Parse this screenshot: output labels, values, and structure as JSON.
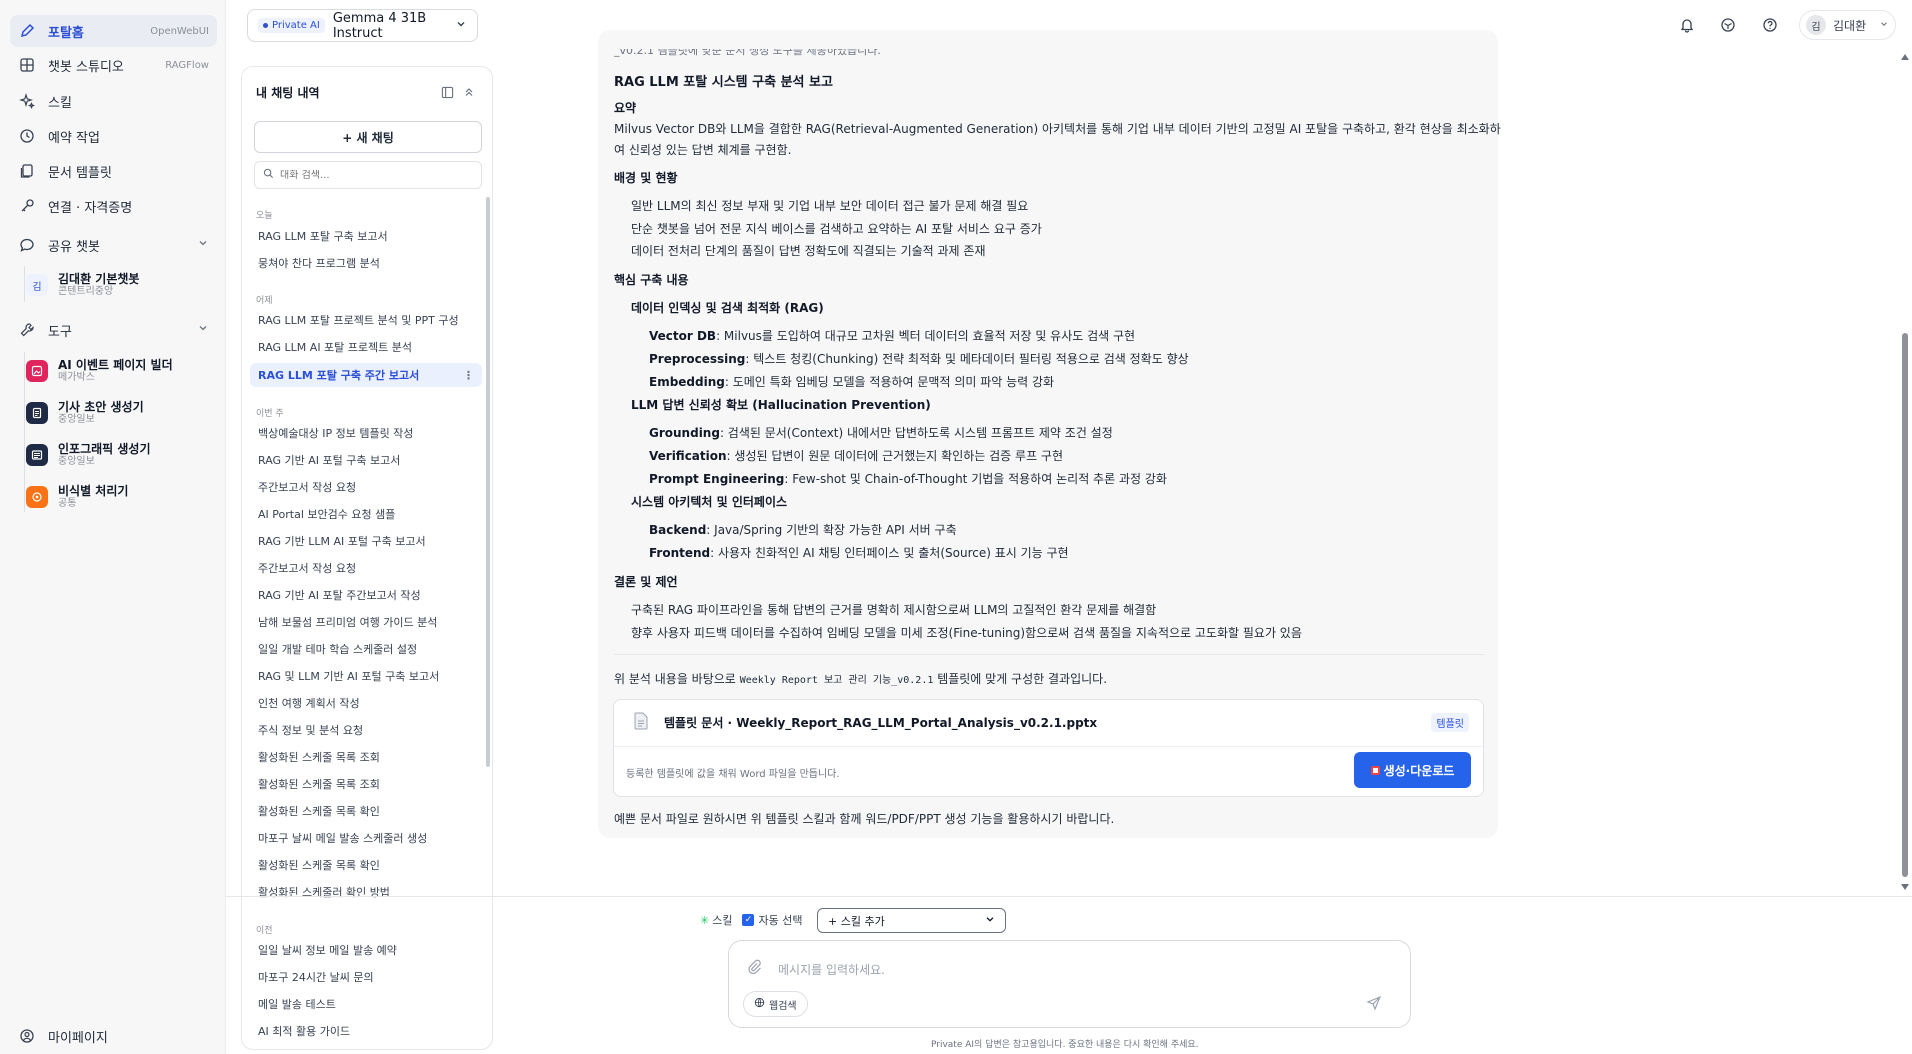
{
  "nav": {
    "items": [
      {
        "label": "포탈홈",
        "tag": "OpenWebUI"
      },
      {
        "label": "챗봇 스튜디오",
        "tag": "RAGFlow"
      },
      {
        "label": "스킬",
        "tag": ""
      },
      {
        "label": "예약 작업",
        "tag": ""
      },
      {
        "label": "문서 템플릿",
        "tag": ""
      },
      {
        "label": "연결 · 자격증명",
        "tag": ""
      }
    ],
    "shared_label": "공유 챗봇",
    "shared_bot": {
      "badge": "김",
      "name": "김대환 기본챗봇",
      "sub": "콘텐트리중앙"
    },
    "tools_label": "도구",
    "tools": [
      {
        "name": "AI 이벤트 페이지 빌더",
        "sub": "메가박스",
        "color": "#e0245e"
      },
      {
        "name": "기사 초안 생성기",
        "sub": "중앙일보",
        "color": "#1f2a44"
      },
      {
        "name": "인포그래픽 생성기",
        "sub": "중앙일보",
        "color": "#1f2a44"
      },
      {
        "name": "비식별 처리기",
        "sub": "공통",
        "color": "#f97316"
      }
    ],
    "mypage": "마이페이지"
  },
  "chat_panel": {
    "title": "내 채팅 내역",
    "new_chat": "+ 새 채팅",
    "search_placeholder": "대화 검색...",
    "groups": {
      "today": "오늘",
      "yesterday": "어제",
      "this_week": "이번 주",
      "earlier": "이전"
    },
    "today": [
      "RAG LLM 포탈 구축 보고서",
      "뭉쳐야 찬다 프로그램 분석"
    ],
    "yesterday": [
      "RAG LLM 포탈 프로젝트 분석 및 PPT 구성",
      "RAG LLM AI 포탈 프로젝트 분석",
      "RAG LLM 포탈 구축 주간 보고서"
    ],
    "this_week": [
      "백상예술대상 IP 정보 템플릿 작성",
      "RAG 기반 AI 포털 구축 보고서",
      "주간보고서 작성 요청",
      "AI Portal 보안검수 요청 샘플",
      "RAG 기반 LLM AI 포털 구축 보고서",
      "주간보고서 작성 요청",
      "RAG 기반 AI 포탈 주간보고서 작성",
      "남해 보물섬 프리미엄 여행 가이드 분석",
      "일일 개발 테마 학습 스케줄러 설정",
      "RAG 및 LLM 기반 AI 포털 구축 보고서",
      "인천 여행 계획서 작성",
      "주식 정보 및 분석 요청",
      "활성화된 스케줄 목록 조회",
      "활성화된 스케줄 목록 조회",
      "활성화된 스케줄 목록 확인",
      "마포구 날씨 메일 발송 스케줄러 생성",
      "활성화된 스케줄 목록 확인",
      "활성화된 스케줄러 확인 방법"
    ],
    "earlier": [
      "일일 날씨 정보 메일 발송 예약",
      "마포구 24시간 날씨 문의",
      "메일 발송 테스트",
      "AI 최적 활용 가이드"
    ]
  },
  "topbar": {
    "badge": "Private AI",
    "model": "Gemma 4 31B Instruct",
    "user_initial": "김",
    "user_name": "김대환"
  },
  "message": {
    "cut_line": "_v0.2.1 템플릿에 맞춘 문서 생성 도구를 제공하였습니다.",
    "title": "RAG LLM 포탈 시스템 구축 분석 보고",
    "summary_h": "요약",
    "summary_1": "Milvus Vector DB와 LLM을 결합한 RAG(Retrieval-Augmented Generation) 아키텍처를 통해 기업 내부 데이터 기반의 고정밀 AI 포탈을 구축하고, 환각 현상을 최소화하",
    "summary_2": "여 신뢰성 있는 답변 체계를 구현함.",
    "bg_h": "배경 및 현황",
    "bg": [
      "일반 LLM의 최신 정보 부재 및 기업 내부 보안 데이터 접근 불가 문제 해결 필요",
      "단순 챗봇을 넘어 전문 지식 베이스를 검색하고 요약하는 AI 포탈 서비스 요구 증가",
      "데이터 전처리 단계의 품질이 답변 정확도에 직결되는 기술적 과제 존재"
    ],
    "core_h": "핵심 구축 내용",
    "sec1": "데이터 인덱싱 및 검색 최적화 (RAG)",
    "sec1_items": [
      {
        "k": "Vector DB",
        "v": ": Milvus를 도입하여 대규모 고차원 벡터 데이터의 효율적 저장 및 유사도 검색 구현"
      },
      {
        "k": "Preprocessing",
        "v": ": 텍스트 청킹(Chunking) 전략 최적화 및 메타데이터 필터링 적용으로 검색 정확도 향상"
      },
      {
        "k": "Embedding",
        "v": ": 도메인 특화 임베딩 모델을 적용하여 문맥적 의미 파악 능력 강화"
      }
    ],
    "sec2": "LLM 답변 신뢰성 확보 (Hallucination Prevention)",
    "sec2_items": [
      {
        "k": "Grounding",
        "v": ": 검색된 문서(Context) 내에서만 답변하도록 시스템 프롬프트 제약 조건 설정"
      },
      {
        "k": "Verification",
        "v": ": 생성된 답변이 원문 데이터에 근거했는지 확인하는 검증 루프 구현"
      },
      {
        "k": "Prompt Engineering",
        "v": ": Few-shot 및 Chain-of-Thought 기법을 적용하여 논리적 추론 과정 강화"
      }
    ],
    "sec3": "시스템 아키텍처 및 인터페이스",
    "sec3_items": [
      {
        "k": "Backend",
        "v": ": Java/Spring 기반의 확장 가능한 API 서버 구축"
      },
      {
        "k": "Frontend",
        "v": ": 사용자 친화적인 AI 채팅 인터페이스 및 출처(Source) 표시 기능 구현"
      }
    ],
    "concl_h": "결론 및 제언",
    "concl": [
      "구축된 RAG 파이프라인을 통해 답변의 근거를 명확히 제시함으로써 LLM의 고질적인 환각 문제를 해결함",
      "향후 사용자 피드백 데이터를 수집하여 임베딩 모델을 미세 조정(Fine-tuning)함으로써 검색 품질을 지속적으로 고도화할 필요가 있음"
    ],
    "basis_pre": "위 분석 내용을 바탕으로",
    "basis_code": "Weekly Report 보고 관리 기능_v0.2.1",
    "basis_post": "템플릿에 맞게 구성한 결과입니다.",
    "template_file": "템플릿 문서 · Weekly_Report_RAG_LLM_Portal_Analysis_v0.2.1.pptx",
    "template_tag": "템플릿",
    "template_desc": "등록한 템플릿에 값을 채워 Word 파일을 만듭니다.",
    "download": "생성·다운로드",
    "footer_note": "예쁜 문서 파일로 원하시면 위 템플릿 스킬과 함께 워드/PDF/PPT 생성 기능을 활용하시기 바랍니다."
  },
  "composer": {
    "skill_label": "스킬",
    "auto_select": "자동 선택",
    "skill_add": "+ 스킬 추가",
    "placeholder": "메시지를 입력하세요.",
    "web_search": "웹검색",
    "disclaimer": "Private AI의 답변은 참고용입니다. 중요한 내용은 다시 확인해 주세요."
  },
  "colors": {
    "accent": "#2563eb",
    "active_nav": "#2b4fd6"
  }
}
